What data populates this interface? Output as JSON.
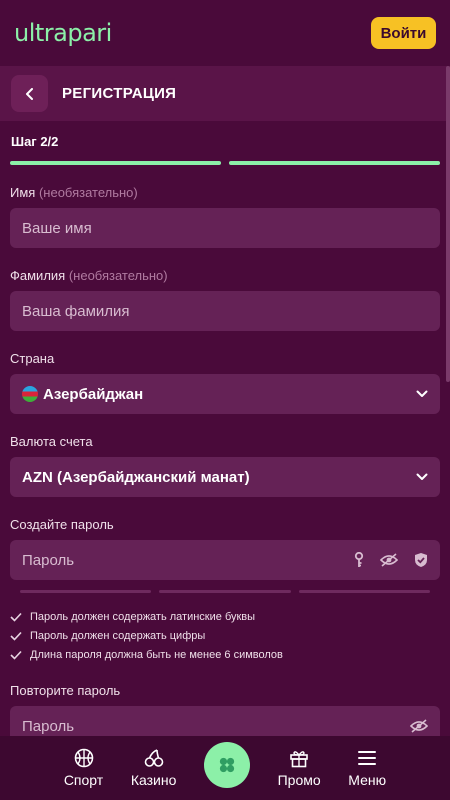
{
  "header": {
    "logo": "ultrapari",
    "login_label": "Войти"
  },
  "titlebar": {
    "title": "РЕГИСТРАЦИЯ"
  },
  "step": "Шаг 2/2",
  "first_name": {
    "label": "Имя",
    "optional": "(необязательно)",
    "placeholder": "Ваше имя"
  },
  "last_name": {
    "label": "Фамилия",
    "optional": "(необязательно)",
    "placeholder": "Ваша фамилия"
  },
  "country": {
    "label": "Страна",
    "value": "Азербайджан"
  },
  "currency": {
    "label": "Валюта счета",
    "value": "AZN (Азербайджанский манат)"
  },
  "password": {
    "label": "Создайте пароль",
    "placeholder": "Пароль"
  },
  "rules": [
    "Пароль должен содержать латинские буквы",
    "Пароль должен содержать цифры",
    "Длина пароля должна быть не менее 6 символов"
  ],
  "repeat_password": {
    "label": "Повторите пароль",
    "placeholder": "Пароль"
  },
  "nav": {
    "sport": "Спорт",
    "casino": "Казино",
    "promo": "Промо",
    "menu": "Меню"
  },
  "colors": {
    "background": "#4a0a3a",
    "accent": "#8cf0a8",
    "button": "#f7c124",
    "field": "#652256"
  }
}
